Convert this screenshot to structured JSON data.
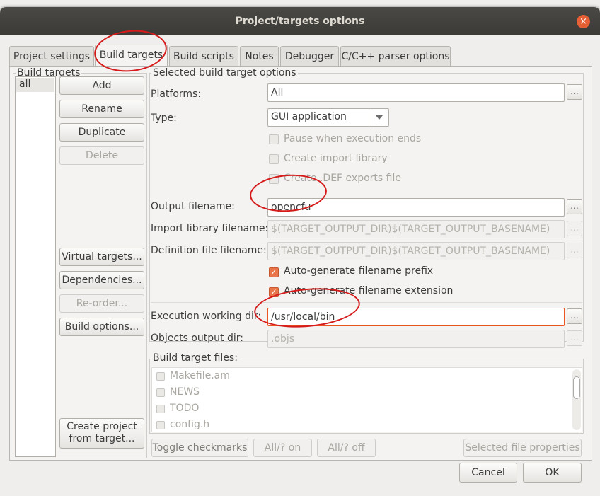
{
  "dialog": {
    "title": "Project/targets options",
    "close_glyph": "×"
  },
  "tabs": [
    {
      "label": "Project settings"
    },
    {
      "label": "Build targets",
      "active": true
    },
    {
      "label": "Build scripts"
    },
    {
      "label": "Notes"
    },
    {
      "label": "Debugger"
    },
    {
      "label": "C/C++ parser options"
    }
  ],
  "build_targets": {
    "group_label": "Build targets",
    "list": [
      "all"
    ],
    "buttons": {
      "add": "Add",
      "rename": "Rename",
      "duplicate": "Duplicate",
      "delete": "Delete",
      "virtual_targets": "Virtual targets...",
      "dependencies": "Dependencies...",
      "reorder": "Re-order...",
      "build_options": "Build options...",
      "create_from_target_line1": "Create project",
      "create_from_target_line2": "from target..."
    }
  },
  "options": {
    "group_label": "Selected build target options",
    "platforms_label": "Platforms:",
    "platforms_value": "All",
    "type_label": "Type:",
    "type_value": "GUI application",
    "pause_label": "Pause when execution ends",
    "import_lib_label": "Create import library",
    "def_exports_label": "Create .DEF exports file",
    "output_filename_label": "Output filename:",
    "output_filename_value": "opencfu",
    "import_lib_filename_label": "Import library filename:",
    "import_lib_filename_value": "$(TARGET_OUTPUT_DIR)$(TARGET_OUTPUT_BASENAME)",
    "def_filename_label": "Definition file filename:",
    "def_filename_value": "$(TARGET_OUTPUT_DIR)$(TARGET_OUTPUT_BASENAME)",
    "auto_prefix_label": "Auto-generate filename prefix",
    "auto_extension_label": "Auto-generate filename extension",
    "exec_dir_label": "Execution working dir:",
    "exec_dir_value": "/usr/local/bin",
    "objects_dir_label": "Objects output dir:",
    "objects_dir_value": ".objs",
    "browse_label": "..."
  },
  "files": {
    "group_label": "Build target files:",
    "items": [
      "Makefile.am",
      "NEWS",
      "TODO",
      "config.h"
    ],
    "toggle": "Toggle checkmarks",
    "all_on": "All/? on",
    "all_off": "All/? off",
    "properties": "Selected file properties"
  },
  "footer": {
    "cancel": "Cancel",
    "ok": "OK"
  },
  "colors": {
    "accent": "#e95420",
    "annotation": "#d51a1a",
    "titlebar": "#3c3b37"
  }
}
